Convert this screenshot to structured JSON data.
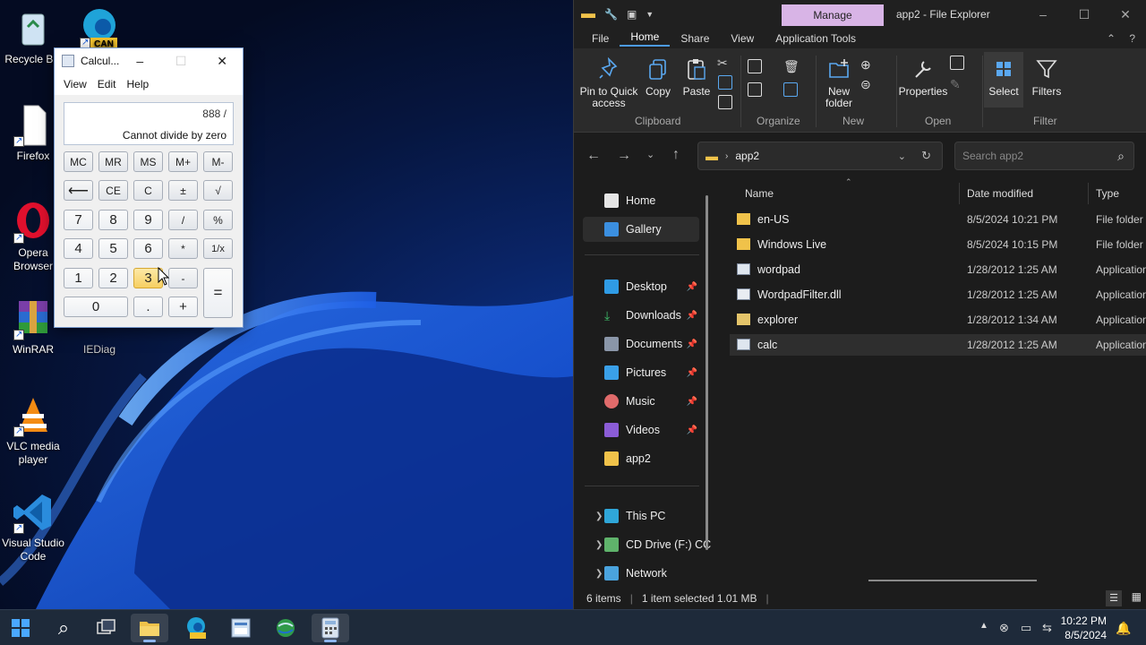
{
  "desktop": {
    "icons": [
      {
        "label": "Recycle Bin",
        "icon": "recycle-bin-icon"
      },
      {
        "label": "Firefox",
        "icon": "firefox-icon"
      },
      {
        "label": "Opera Browser",
        "icon": "opera-icon"
      },
      {
        "label": "WinRAR",
        "icon": "winrar-icon"
      },
      {
        "label": "IEDiag",
        "icon": "iediag-icon"
      },
      {
        "label": "VLC media player",
        "icon": "vlc-icon"
      },
      {
        "label": "Visual Studio Code",
        "icon": "vscode-icon"
      },
      {
        "label": "CAN",
        "icon": "edge-can-icon"
      }
    ]
  },
  "calculator": {
    "title": "Calcul...",
    "menu": [
      "View",
      "Edit",
      "Help"
    ],
    "expression": "888  /",
    "result": "Cannot divide by zero",
    "buttons": {
      "mc": "MC",
      "mr": "MR",
      "ms": "MS",
      "mplus": "M+",
      "mminus": "M-",
      "back": "⟵",
      "ce": "CE",
      "c": "C",
      "plusminus": "±",
      "sqrt": "√",
      "n7": "7",
      "n8": "8",
      "n9": "9",
      "div": "/",
      "pct": "%",
      "n4": "4",
      "n5": "5",
      "n6": "6",
      "mul": "*",
      "recip": "1/x",
      "n1": "1",
      "n2": "2",
      "n3": "3",
      "sub": "-",
      "eq": "=",
      "n0": "0",
      "dot": ".",
      "add": "+"
    }
  },
  "explorer": {
    "manage_label": "Manage",
    "window_title": "app2 - File Explorer",
    "tabs": [
      "File",
      "Home",
      "Share",
      "View",
      "Application Tools"
    ],
    "active_tab": "Home",
    "ribbon": {
      "pin": "Pin to Quick access",
      "copy": "Copy",
      "paste": "Paste",
      "new_folder": "New folder",
      "properties": "Properties",
      "select": "Select",
      "filters": "Filters",
      "groups": {
        "clipboard": "Clipboard",
        "organize": "Organize",
        "new": "New",
        "open": "Open",
        "filter": "Filter"
      }
    },
    "address": "app2",
    "search_placeholder": "Search app2",
    "nav": {
      "home": "Home",
      "gallery": "Gallery",
      "desktop": "Desktop",
      "downloads": "Downloads",
      "documents": "Documents",
      "pictures": "Pictures",
      "music": "Music",
      "videos": "Videos",
      "app2": "app2",
      "thispc": "This PC",
      "cddrive": "CD Drive (F:) CC",
      "network": "Network"
    },
    "columns": {
      "name": "Name",
      "date": "Date modified",
      "type": "Type"
    },
    "rows": [
      {
        "name": "en-US",
        "date": "8/5/2024 10:21 PM",
        "type": "File folder",
        "icon": "folder"
      },
      {
        "name": "Windows Live",
        "date": "8/5/2024 10:15 PM",
        "type": "File folder",
        "icon": "folder"
      },
      {
        "name": "wordpad",
        "date": "1/28/2012 1:25 AM",
        "type": "Application",
        "icon": "app"
      },
      {
        "name": "WordpadFilter.dll",
        "date": "1/28/2012 1:25 AM",
        "type": "Application",
        "icon": "dll"
      },
      {
        "name": "explorer",
        "date": "1/28/2012 1:34 AM",
        "type": "Application",
        "icon": "folder-app"
      },
      {
        "name": "calc",
        "date": "1/28/2012 1:25 AM",
        "type": "Application",
        "icon": "app"
      }
    ],
    "status": {
      "items": "6 items",
      "selected": "1 item selected  1.01 MB"
    }
  },
  "taskbar": {
    "time": "10:22 PM",
    "date": "8/5/2024"
  },
  "colors": {
    "accent": "#4c9be8",
    "manage_bg": "#d8b4e6",
    "calc_hot": "#f6cf62"
  }
}
